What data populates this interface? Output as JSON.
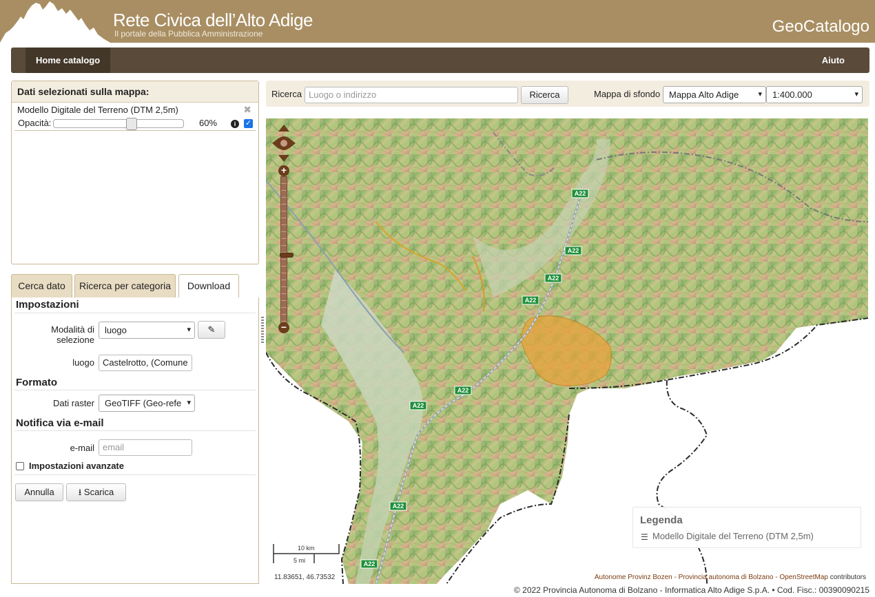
{
  "header": {
    "site_title": "Rete Civica dell’Alto Adige",
    "site_subtitle": "Il portale della Pubblica Amministrazione",
    "app_name": "GeoCatalogo"
  },
  "nav": {
    "home": "Home catalogo",
    "help": "Aiuto"
  },
  "selected_panel": {
    "title": "Dati selezionati sulla mappa:",
    "layer": {
      "name": "Modello Digitale del Terreno (DTM 2,5m)",
      "opacity_label": "Opacità:",
      "opacity_value": "60%",
      "opacity_fraction": 0.6,
      "visible": true
    }
  },
  "tabs": [
    "Cerca dato",
    "Ricerca per categoria",
    "Download"
  ],
  "download": {
    "section_settings": "Impostazioni",
    "mode_label": "Modalità di selezione",
    "mode_value": "luogo",
    "place_label": "luogo",
    "place_value": "Castelrotto, (Comune",
    "section_format": "Formato",
    "raster_label": "Dati raster",
    "raster_value": "GeoTIFF (Geo-refe",
    "section_notify": "Notifica via e-mail",
    "email_label": "e-mail",
    "email_placeholder": "email",
    "advanced_label": "Impostazioni avanzate",
    "cancel_label": "Annulla",
    "download_label": "Scarica"
  },
  "search": {
    "label": "Ricerca",
    "placeholder": "Luogo o indirizzo",
    "button": "Ricerca",
    "bg_label": "Mappa di sfondo",
    "bg_value": "Mappa Alto Adige",
    "scale_value": "1:400.000"
  },
  "map": {
    "road_label": "A22",
    "legend_title": "Legenda",
    "legend_item": "Modello Digitale del Terreno (DTM 2,5m)",
    "scale_km": "10 km",
    "scale_mi": "5 mi",
    "coords": "11.83651, 46.73532",
    "attribution_link": "Autonome Provinz Bozen - Provincia autonoma di Bolzano - OpenStreetMap",
    "attribution_text": "contributors"
  },
  "footer": "© 2022 Provincia Autonoma di Bolzano - Informatica Alto Adige S.p.A. • Cod. Fisc.: 00390090215",
  "colors": {
    "header_bg": "#a88e62",
    "nav_bg": "#594a39",
    "panel_border": "#c9b895",
    "highlight_area": "#e8a23a",
    "zoom_ctrl": "#6b3d1a"
  }
}
